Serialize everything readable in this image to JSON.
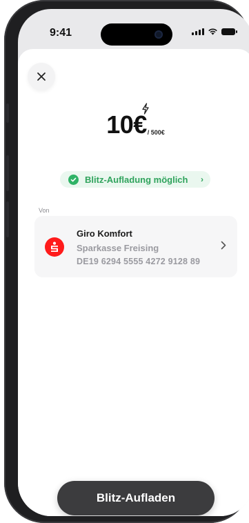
{
  "status_bar": {
    "time": "9:41"
  },
  "amount": {
    "value": "10€",
    "limit": "/ 500€",
    "icon": "lightning-bolt-icon"
  },
  "badge": {
    "label": "Blitz-Aufladung möglich",
    "color": "#2fa35c"
  },
  "from": {
    "label": "Von",
    "account_name": "Giro Komfort",
    "bank_name": "Sparkasse Freising",
    "iban": "DE19 6294 5555 4272 9128 89",
    "bank_color": "#ff1b1b"
  },
  "cta": {
    "label": "Blitz-Aufladen"
  }
}
